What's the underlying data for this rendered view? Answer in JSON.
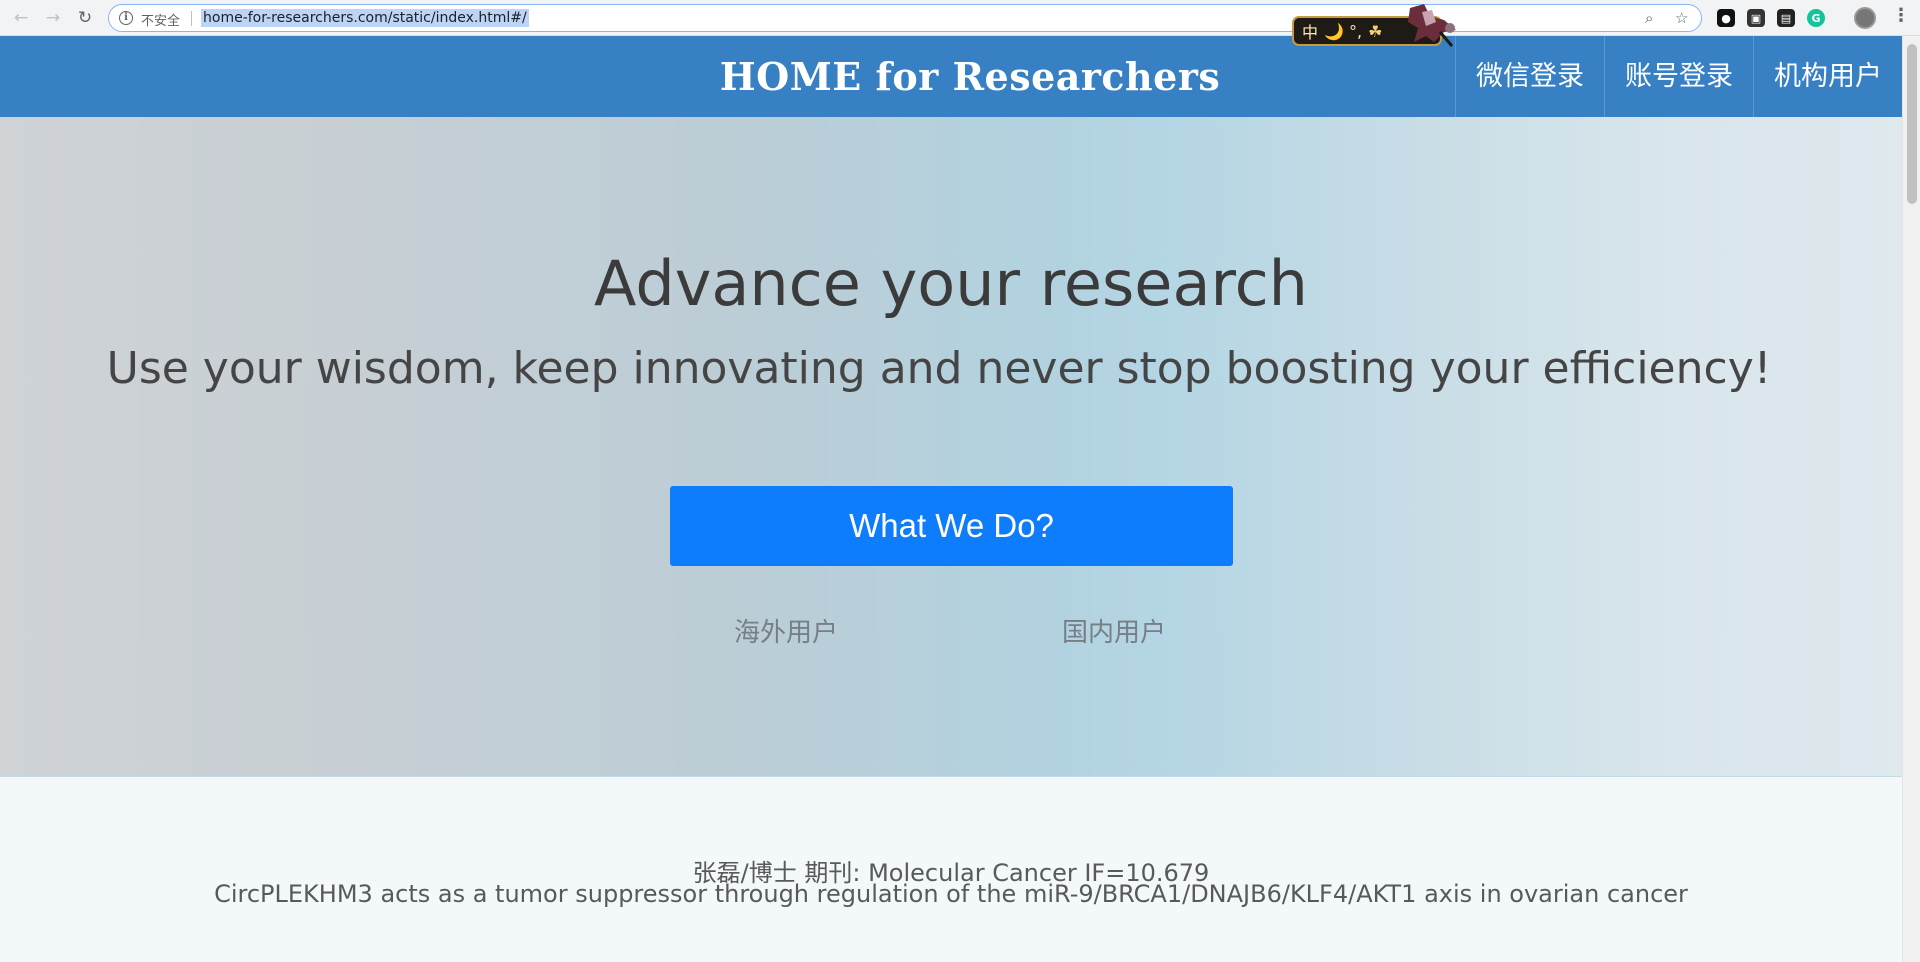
{
  "browser": {
    "insecure_label": "不安全",
    "url": "home-for-researchers.com/static/index.html#/",
    "ime_label": "中",
    "ime_extra": "🌙 °,"
  },
  "header": {
    "site_title": "HOME for Researchers",
    "nav": [
      {
        "label": "微信登录"
      },
      {
        "label": "账号登录"
      },
      {
        "label": "机构用户"
      }
    ]
  },
  "hero": {
    "title": "Advance your research",
    "subtitle": "Use your wisdom, keep innovating and never stop boosting your efficiency!",
    "cta_label": "What We Do?",
    "overseas_label": "海外用户",
    "domestic_label": "国内用户"
  },
  "featured_paper": {
    "author_line": "张磊/博士 期刊: Molecular Cancer IF=10.679",
    "title": "CircPLEKHM3 acts as a tumor suppressor through regulation of the miR-9/BRCA1/DNAJB6/KLF4/AKT1 axis in ovarian cancer"
  },
  "colors": {
    "header_blue": "#3880c4",
    "cta_blue": "#0d7dfb"
  }
}
